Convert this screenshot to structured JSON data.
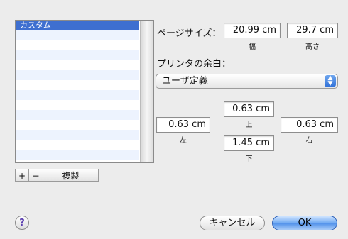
{
  "paper_list": {
    "items": [
      {
        "label": "カスタム",
        "selected": true
      }
    ],
    "empty_rows": 14
  },
  "list_buttons": {
    "add": "+",
    "remove": "−",
    "duplicate": "複製"
  },
  "page_size": {
    "label": "ページサイズ：",
    "width_value": "20.99 cm",
    "width_caption": "幅",
    "height_value": "29.7 cm",
    "height_caption": "高さ"
  },
  "margins": {
    "label": "プリンタの余白：",
    "preset_selected": "ユーザ定義",
    "top_value": "0.63 cm",
    "top_caption": "上",
    "left_value": "0.63 cm",
    "left_caption": "左",
    "right_value": "0.63 cm",
    "right_caption": "右",
    "bottom_value": "1.45 cm",
    "bottom_caption": "下"
  },
  "footer": {
    "help": "?",
    "cancel": "キャンセル",
    "ok": "OK"
  },
  "colors": {
    "selection": "#3e6fd0",
    "default_button": "#4f90ea"
  }
}
